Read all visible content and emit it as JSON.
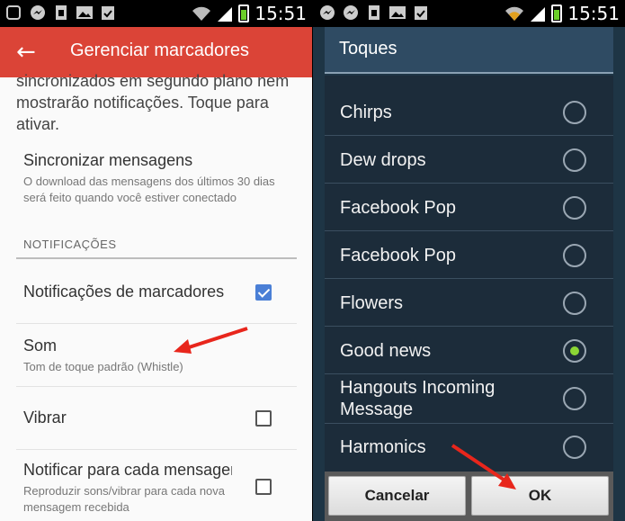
{
  "left": {
    "status_time": "15:51",
    "appbar": {
      "title": "Gerenciar marcadores",
      "back_icon": "arrow-left-icon"
    },
    "intro_text": "sincronizados em segundo plano nem mostrarão notificações. Toque para ativar.",
    "sync": {
      "title": "Sincronizar mensagens",
      "subtitle": "O download das mensagens dos últimos 30 dias será feito quando você estiver conectado"
    },
    "section_header": "NOTIFICAÇÕES",
    "label_notifications": {
      "title": "Notificações de marcadores",
      "checked": true
    },
    "sound": {
      "title": "Som",
      "subtitle": "Tom de toque padrão (Whistle)"
    },
    "vibrate": {
      "title": "Vibrar",
      "checked": false
    },
    "notify_each": {
      "title": "Notificar para cada mensagem",
      "subtitle": "Reproduzir sons/vibrar para cada nova mensagem recebida",
      "checked": false
    },
    "accent_color": "#db4437"
  },
  "right": {
    "status_time": "15:51",
    "dialog": {
      "title": "Toques",
      "options": [
        {
          "label": "Chirps",
          "selected": false
        },
        {
          "label": "Dew drops",
          "selected": false
        },
        {
          "label": "Facebook Pop",
          "selected": false
        },
        {
          "label": "Facebook Pop",
          "selected": false
        },
        {
          "label": "Flowers",
          "selected": false
        },
        {
          "label": "Good news",
          "selected": true
        },
        {
          "label": "Hangouts Incoming Message",
          "selected": false
        },
        {
          "label": "Harmonics",
          "selected": false
        }
      ],
      "cancel_label": "Cancelar",
      "ok_label": "OK"
    },
    "selected_color": "#8bd635"
  }
}
